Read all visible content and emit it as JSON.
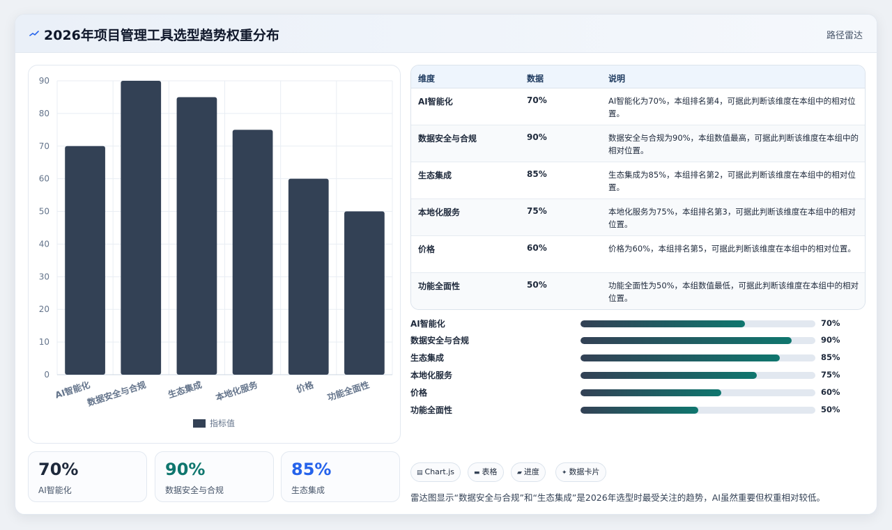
{
  "header": {
    "title": "2026年项目管理工具选型趋势权重分布",
    "chart_type_label": "路径雷达"
  },
  "colors": {
    "bar": "#334155",
    "accent_green": "#0f766e",
    "accent_blue": "#2563eb",
    "dark": "#1e293b"
  },
  "chart_data": {
    "type": "bar",
    "categories": [
      "AI智能化",
      "数据安全与合规",
      "生态集成",
      "本地化服务",
      "价格",
      "功能全面性"
    ],
    "series": [
      {
        "name": "指标值",
        "values": [
          70,
          90,
          85,
          75,
          60,
          50
        ]
      }
    ],
    "y_ticks": [
      "0",
      "10",
      "20",
      "30",
      "40",
      "50",
      "60",
      "70",
      "80",
      "90"
    ],
    "ylim": [
      0,
      90
    ],
    "grid": true,
    "legend": "bottom"
  },
  "kpis": [
    {
      "value": "70%",
      "label": "AI智能化"
    },
    {
      "value": "90%",
      "label": "数据安全与合规"
    },
    {
      "value": "85%",
      "label": "生态集成"
    }
  ],
  "table": {
    "headers": [
      "维度",
      "数据",
      "说明"
    ],
    "rows": [
      {
        "dim": "AI智能化",
        "value": "70%",
        "desc": "AI智能化为70%，本组排名第4，可据此判断该维度在本组中的相对位置。"
      },
      {
        "dim": "数据安全与合规",
        "value": "90%",
        "desc": "数据安全与合规为90%，本组数值最高，可据此判断该维度在本组中的相对位置。"
      },
      {
        "dim": "生态集成",
        "value": "85%",
        "desc": "生态集成为85%，本组排名第2，可据此判断该维度在本组中的相对位置。"
      },
      {
        "dim": "本地化服务",
        "value": "75%",
        "desc": "本地化服务为75%，本组排名第3，可据此判断该维度在本组中的相对位置。"
      },
      {
        "dim": "价格",
        "value": "60%",
        "desc": "价格为60%，本组排名第5，可据此判断该维度在本组中的相对位置。"
      },
      {
        "dim": "功能全面性",
        "value": "50%",
        "desc": "功能全面性为50%，本组数值最低，可据此判断该维度在本组中的相对位置。"
      }
    ]
  },
  "progress": [
    {
      "label": "AI智能化",
      "percent": 70,
      "text": "70%"
    },
    {
      "label": "数据安全与合规",
      "percent": 90,
      "text": "90%"
    },
    {
      "label": "生态集成",
      "percent": 85,
      "text": "85%"
    },
    {
      "label": "本地化服务",
      "percent": 75,
      "text": "75%"
    },
    {
      "label": "价格",
      "percent": 60,
      "text": "60%"
    },
    {
      "label": "功能全面性",
      "percent": 50,
      "text": "50%"
    }
  ],
  "tags": [
    {
      "label": "Chart.js",
      "icon": "chart-icon"
    },
    {
      "label": "表格",
      "icon": "table-icon"
    },
    {
      "label": "进度",
      "icon": "progress-icon"
    },
    {
      "label": "数据卡片",
      "icon": "sparkle-icon"
    }
  ],
  "note": "雷达图显示“数据安全与合规”和“生态集成”是2026年选型时最受关注的趋势，AI虽然重要但权重相对较低。"
}
